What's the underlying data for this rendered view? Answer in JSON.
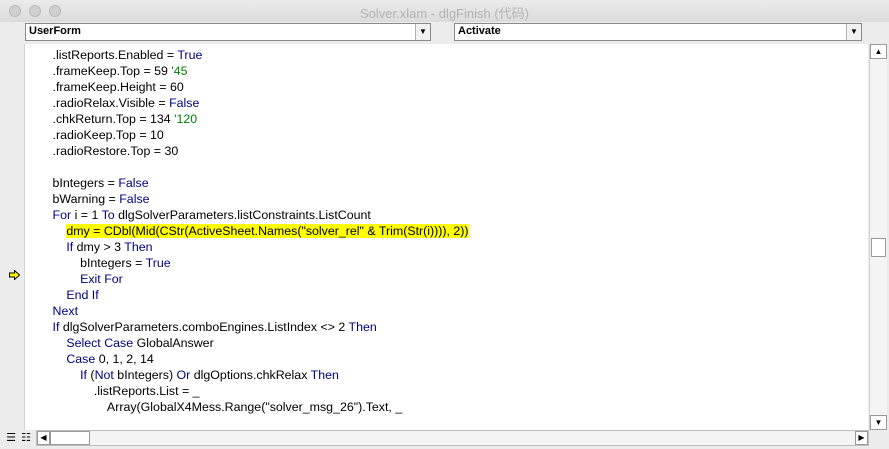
{
  "window": {
    "title": "Solver.xlam - dlgFinish (代码)"
  },
  "object_combo": {
    "value": "UserForm"
  },
  "procedure_combo": {
    "value": "Activate"
  },
  "colors": {
    "keyword": "#000080",
    "comment": "#008000",
    "highlight": "#ffff00",
    "background": "#ffffff"
  },
  "code_lines": [
    [
      {
        "t": "        .listReports.Enabled = "
      },
      {
        "t": "True",
        "c": "kw"
      }
    ],
    [
      {
        "t": "        .frameKeep.Top = 59 "
      },
      {
        "t": "'45",
        "c": "cm"
      }
    ],
    [
      {
        "t": "        .frameKeep.Height = 60"
      }
    ],
    [
      {
        "t": "        .radioRelax.Visible = "
      },
      {
        "t": "False",
        "c": "kw"
      }
    ],
    [
      {
        "t": "        .chkReturn.Top = 134 "
      },
      {
        "t": "'120",
        "c": "cm"
      }
    ],
    [
      {
        "t": "        .radioKeep.Top = 10"
      }
    ],
    [
      {
        "t": "        .radioRestore.Top = 30"
      }
    ],
    [
      {
        "t": ""
      }
    ],
    [
      {
        "t": "        bIntegers = "
      },
      {
        "t": "False",
        "c": "kw"
      }
    ],
    [
      {
        "t": "        bWarning = "
      },
      {
        "t": "False",
        "c": "kw"
      }
    ],
    [
      {
        "t": "        "
      },
      {
        "t": "For",
        "c": "kw"
      },
      {
        "t": " i = 1 "
      },
      {
        "t": "To",
        "c": "kw"
      },
      {
        "t": " dlgSolverParameters.listConstraints.ListCount"
      }
    ],
    [
      {
        "t": "            "
      },
      {
        "t": "dmy = CDbl(Mid(CStr(ActiveSheet.Names(\"solver_rel\" & Trim(Str(i)))), 2))",
        "c": "hl"
      }
    ],
    [
      {
        "t": "            "
      },
      {
        "t": "If",
        "c": "kw"
      },
      {
        "t": " dmy > 3 "
      },
      {
        "t": "Then",
        "c": "kw"
      }
    ],
    [
      {
        "t": "                bIntegers = "
      },
      {
        "t": "True",
        "c": "kw"
      }
    ],
    [
      {
        "t": "                "
      },
      {
        "t": "Exit For",
        "c": "kw"
      }
    ],
    [
      {
        "t": "            "
      },
      {
        "t": "End If",
        "c": "kw"
      }
    ],
    [
      {
        "t": "        "
      },
      {
        "t": "Next",
        "c": "kw"
      }
    ],
    [
      {
        "t": "        "
      },
      {
        "t": "If",
        "c": "kw"
      },
      {
        "t": " dlgSolverParameters.comboEngines.ListIndex <> 2 "
      },
      {
        "t": "Then",
        "c": "kw"
      }
    ],
    [
      {
        "t": "            "
      },
      {
        "t": "Select Case",
        "c": "kw"
      },
      {
        "t": " GlobalAnswer"
      }
    ],
    [
      {
        "t": "            "
      },
      {
        "t": "Case",
        "c": "kw"
      },
      {
        "t": " 0, 1, 2, 14"
      }
    ],
    [
      {
        "t": "                "
      },
      {
        "t": "If",
        "c": "kw"
      },
      {
        "t": " ("
      },
      {
        "t": "Not",
        "c": "kw"
      },
      {
        "t": " bIntegers) "
      },
      {
        "t": "Or",
        "c": "kw"
      },
      {
        "t": " dlgOptions.chkRelax "
      },
      {
        "t": "Then",
        "c": "kw"
      }
    ],
    [
      {
        "t": "                    .listReports.List = _"
      }
    ],
    [
      {
        "t": "                        Array(GlobalX4Mess.Range(\"solver_msg_26\").Text, _"
      }
    ]
  ],
  "icons": {
    "execution_marker": "current-line-arrow-icon",
    "procedure_view": "procedure-view-icon",
    "full_module_view": "full-module-view-icon"
  }
}
